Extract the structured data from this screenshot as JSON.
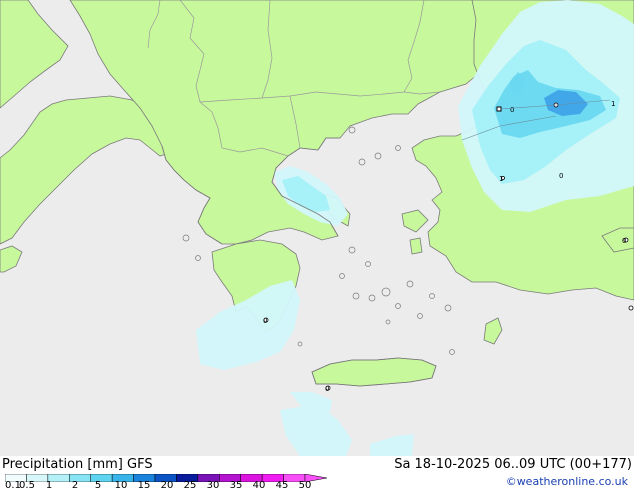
{
  "map": {
    "colors": {
      "sea": "#ececec",
      "land": "#c8f89c",
      "coast": "#7a7a7a",
      "precip_light": "#d2f7fb",
      "precip_med": "#a4f0f8",
      "precip_strong": "#6ad8f0",
      "precip_core": "#3fa4e8"
    },
    "city_values": [
      "0",
      "1",
      "0",
      "0",
      "1",
      "0",
      "0"
    ]
  },
  "footer": {
    "title": "Precipitation [mm]  GFS",
    "run": "Sa 18-10-2025 06..09 UTC (00+177)",
    "credit": "©weatheronline.co.uk"
  },
  "legend": {
    "ticks": [
      "0.1",
      "0.5",
      "1",
      "2",
      "5",
      "10",
      "15",
      "20",
      "25",
      "30",
      "35",
      "40",
      "45",
      "50"
    ],
    "colors": [
      "#f0fcfe",
      "#d8f7fb",
      "#b4f0f8",
      "#88e4f4",
      "#5ed4f0",
      "#38b4e8",
      "#1a84dc",
      "#0c54c4",
      "#081c9c",
      "#7a14b8",
      "#b414d0",
      "#dc14e0",
      "#f01cf0",
      "#f850f8"
    ]
  }
}
